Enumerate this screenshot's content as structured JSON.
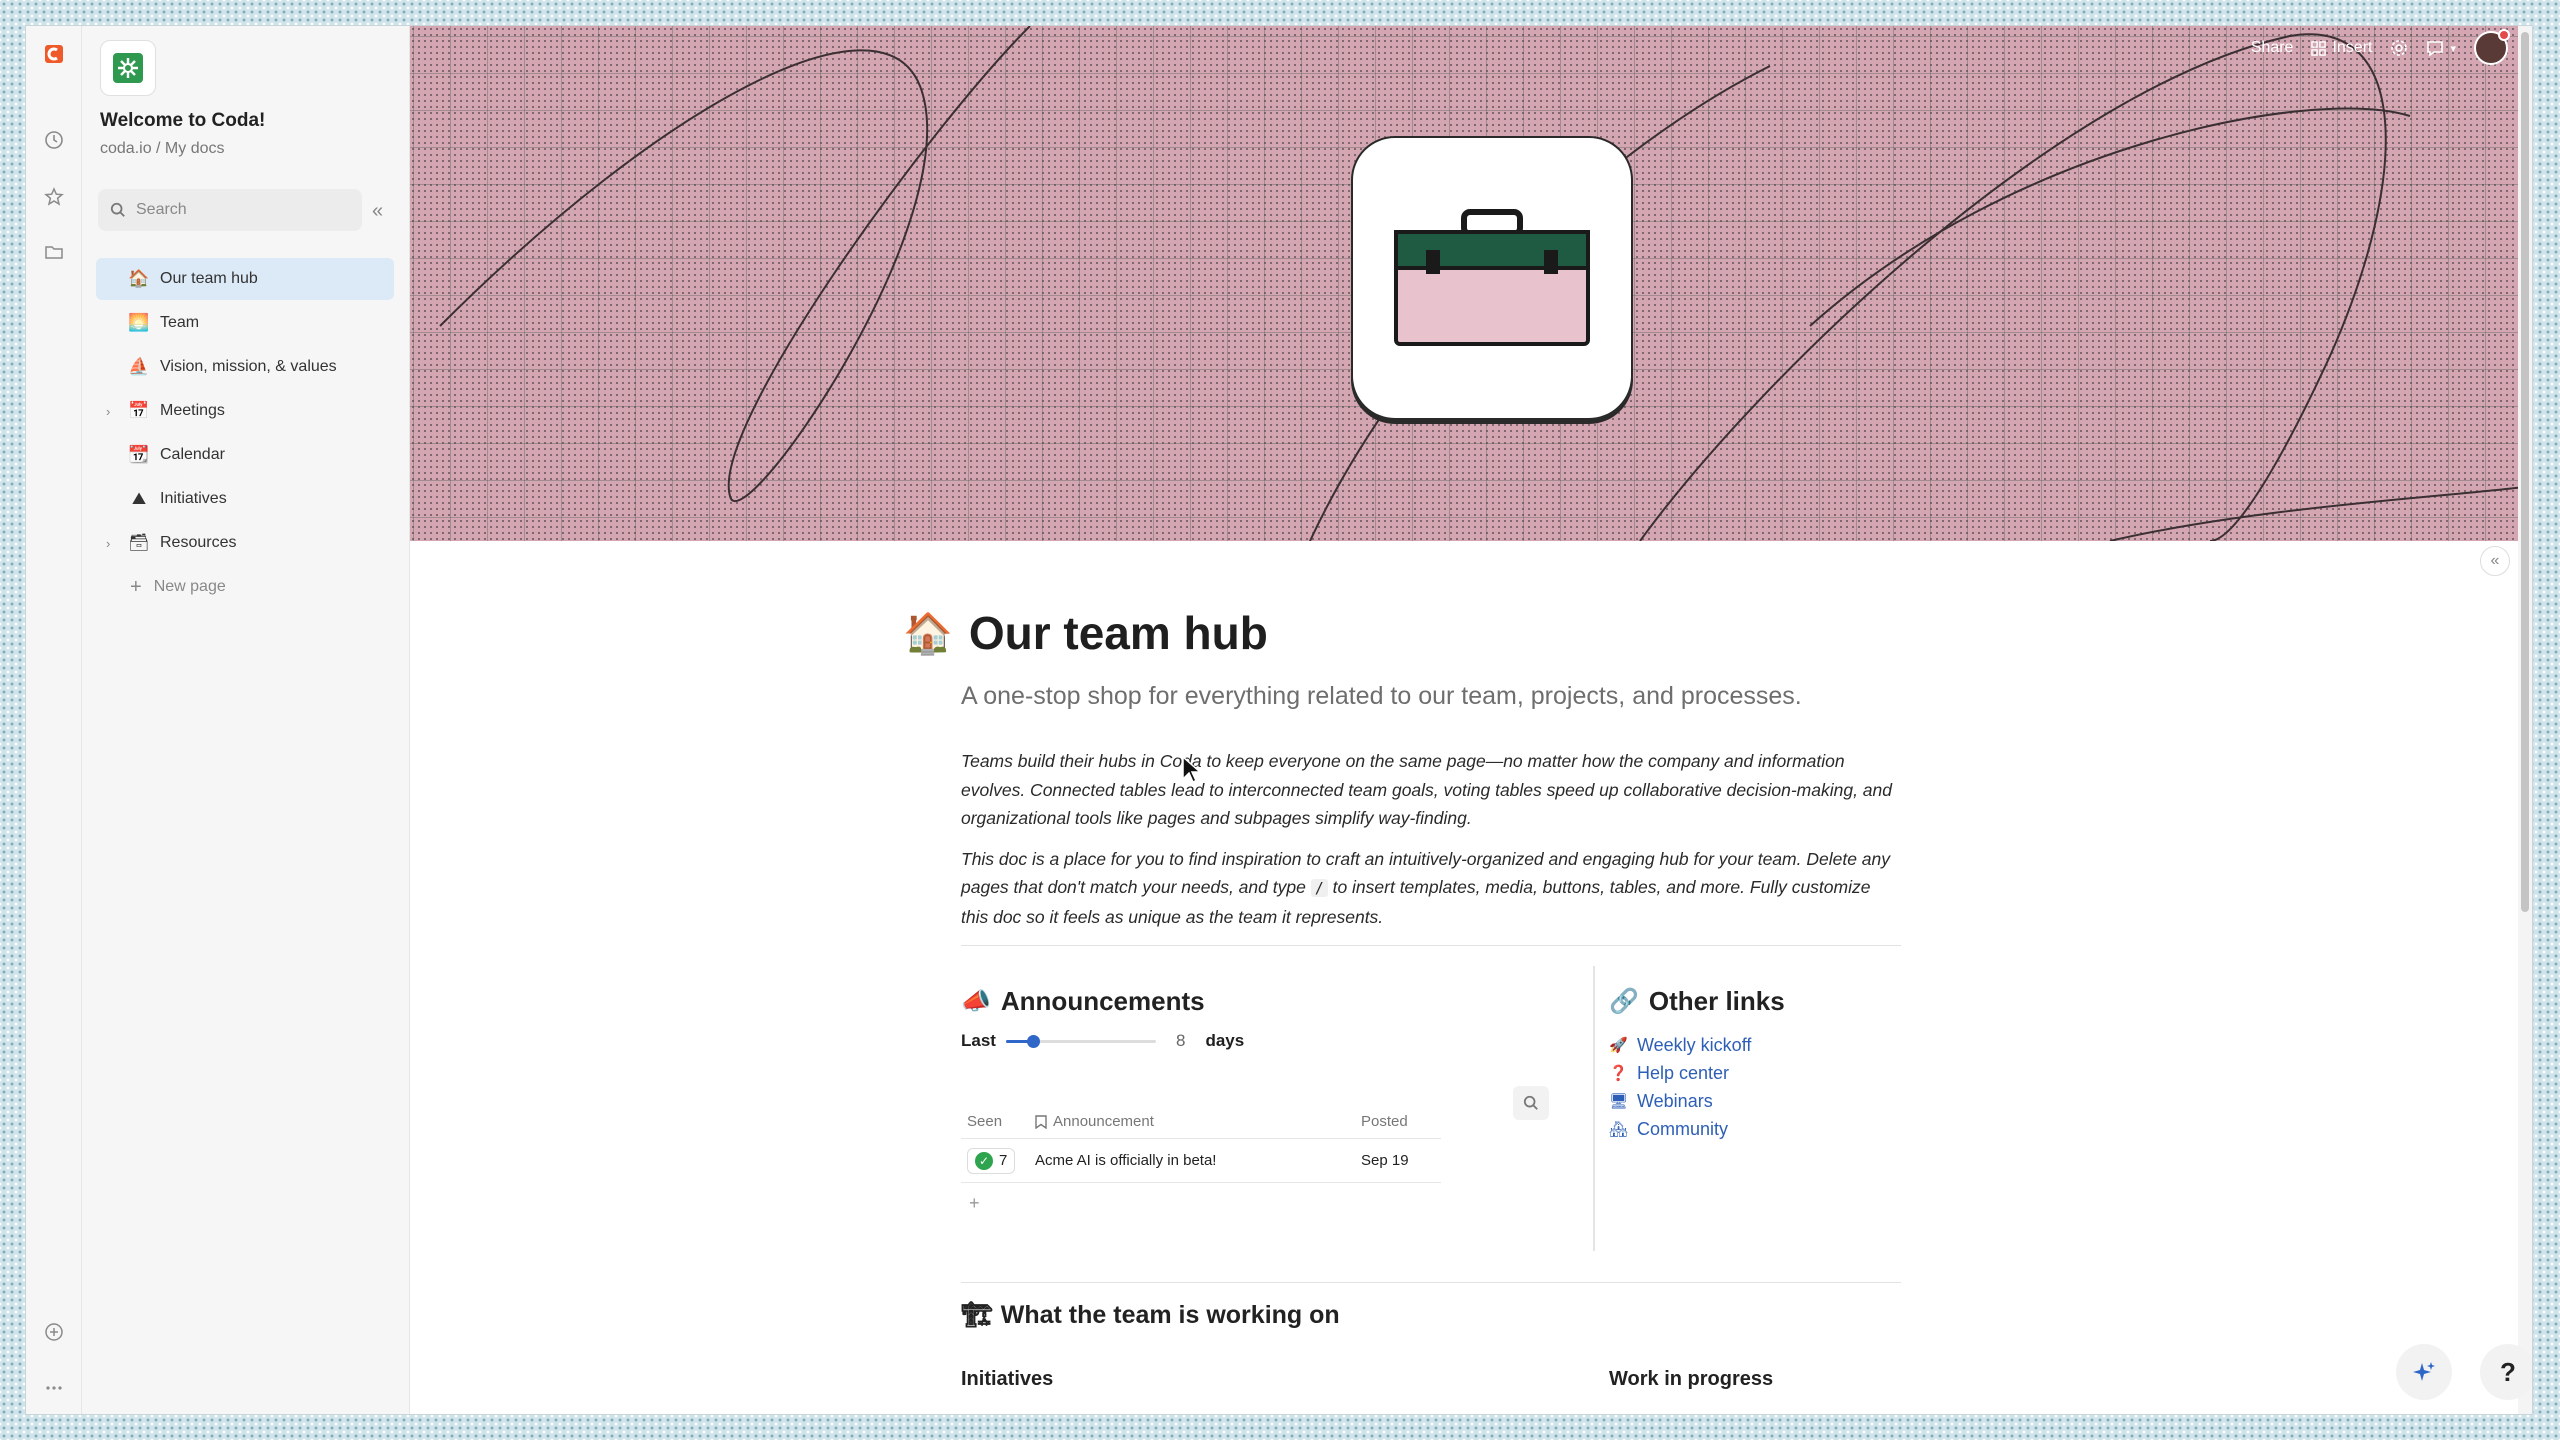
{
  "sidebar": {
    "doc_title": "Welcome to Coda!",
    "doc_path": "coda.io / My docs",
    "search_placeholder": "Search",
    "items": [
      {
        "label": "Our team hub",
        "emoji": "🏠",
        "active": true,
        "expandable": false
      },
      {
        "label": "Team",
        "emoji": "🌅",
        "active": false,
        "expandable": false
      },
      {
        "label": "Vision, mission, & values",
        "emoji": "⛵",
        "active": false,
        "expandable": false
      },
      {
        "label": "Meetings",
        "emoji": "📅",
        "active": false,
        "expandable": true
      },
      {
        "label": "Calendar",
        "emoji": "📆",
        "active": false,
        "expandable": false
      },
      {
        "label": "Initiatives",
        "emoji": "⛰",
        "active": false,
        "expandable": false
      },
      {
        "label": "Resources",
        "emoji": "🗃",
        "active": false,
        "expandable": true
      }
    ],
    "new_page_label": "New page"
  },
  "topbar": {
    "share_label": "Share",
    "insert_label": "Insert"
  },
  "page": {
    "emoji": "🏠",
    "title": "Our team hub",
    "subtitle": "A one-stop shop for everything related to our team, projects, and processes.",
    "para1": "Teams build their hubs in Coda to keep everyone on the same page—no matter how the company and information evolves. Connected tables lead to interconnected team goals, voting tables speed up collaborative decision-making, and organizational tools like pages and subpages simplify way-finding.",
    "para2_before": "This doc is a place for you to find inspiration to craft an intuitively-organized and engaging hub for your team. Delete any pages that don't match your needs, and type ",
    "para2_code": "/",
    "para2_after": " to insert templates, media, buttons, tables, and more.  Fully customize this doc so it feels as unique as the team it represents."
  },
  "announcements": {
    "emoji": "📣",
    "title": "Announcements",
    "filter_prefix": "Last",
    "filter_value": "8",
    "filter_suffix": "days",
    "slider_fraction": 0.18,
    "columns": {
      "seen": "Seen",
      "announcement": "Announcement",
      "posted": "Posted"
    },
    "rows": [
      {
        "seen": "7",
        "announcement": "Acme AI is officially in beta!",
        "posted": "Sep 19"
      }
    ],
    "add_row": "+"
  },
  "other_links": {
    "emoji": "🔗",
    "title": "Other links",
    "items": [
      {
        "emoji": "🚀",
        "label": "Weekly kickoff"
      },
      {
        "emoji": "❓",
        "label": "Help center"
      },
      {
        "emoji": "🖥",
        "label": "Webinars"
      },
      {
        "emoji": "🏘",
        "label": "Community"
      }
    ]
  },
  "working_on": {
    "emoji": "🏗",
    "title": "What the team is working on",
    "left_heading": "Initiatives",
    "right_heading": "Work in progress"
  },
  "help_label": "?",
  "colors": {
    "accent": "#2f67c9",
    "active_nav": "#dce9f7",
    "banner": "#d4a6b2",
    "link": "#2d5fb6",
    "coda_logo": "#ee5a29"
  }
}
